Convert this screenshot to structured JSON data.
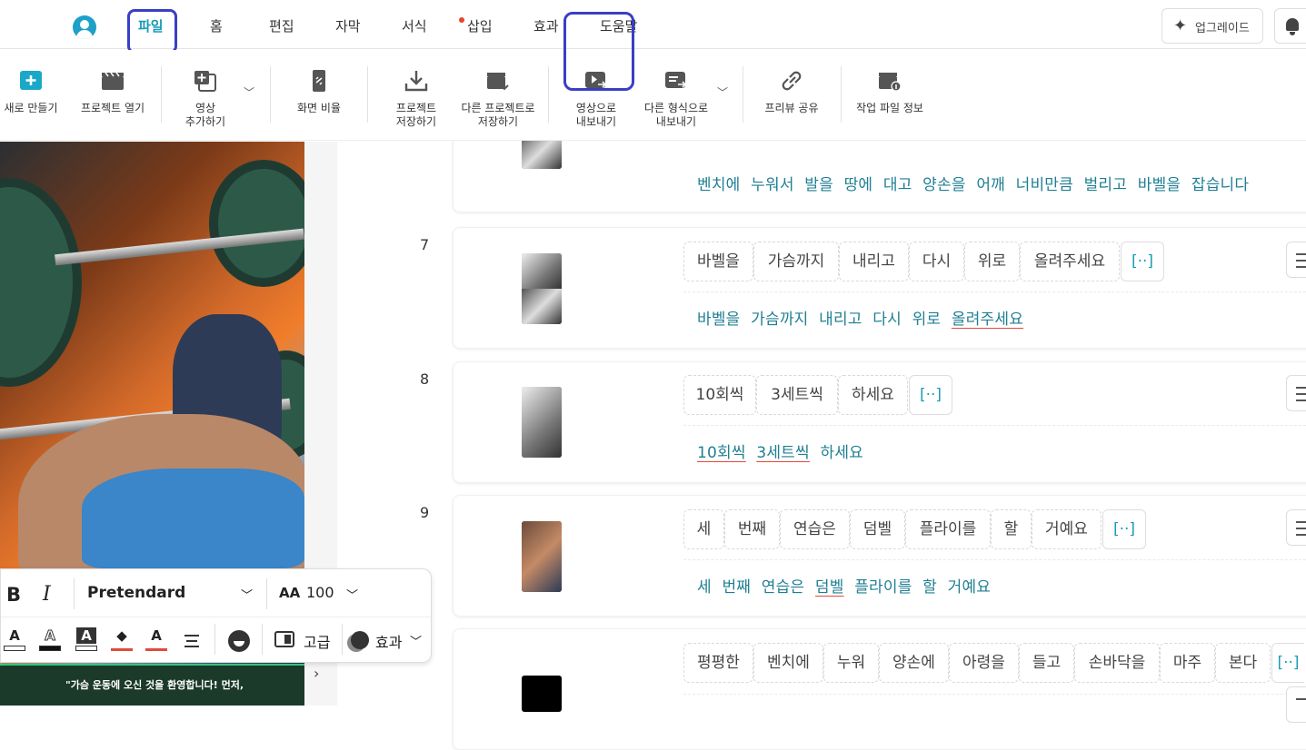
{
  "menu": {
    "tabs": [
      "파일",
      "홈",
      "편집",
      "자막",
      "서식",
      "삽입",
      "효과",
      "도움말"
    ],
    "active_tab": "파일",
    "upgrade_label": "업그레이드"
  },
  "toolbar": {
    "new_label": "새로 만들기",
    "open_label": "프로젝트 열기",
    "add_video_label": "영상\n추가하기",
    "aspect_label": "화면 비율",
    "save_label": "프로젝트\n저장하기",
    "save_as_label": "다른 프로젝트로\n저장하기",
    "export_video_label": "영상으로\n내보내기",
    "export_other_label": "다른 형식으로\n내보내기",
    "share_preview_label": "프리뷰 공유",
    "file_info_label": "작업 파일 정보"
  },
  "format_bar": {
    "bold": "B",
    "italic": "I",
    "font_name": "Pretendard",
    "size_icon": "AA",
    "font_size": "100",
    "quality_label": "고급",
    "effects_label": "효과"
  },
  "preview": {
    "caption_text": "\"가슴 운동에 오신 것을 환영합니다! 먼저,"
  },
  "scenes": {
    "s6": {
      "sentence": [
        "벤치에",
        "누워서",
        "발을",
        "땅에",
        "대고",
        "양손을",
        "어깨",
        "너비만큼",
        "벌리고",
        "바벨을",
        "잡습니다"
      ]
    },
    "s7": {
      "num": "7",
      "chips": [
        "바벨을",
        "가슴까지",
        "내리고",
        "다시",
        "위로",
        "올려주세요",
        "[··]"
      ],
      "sentence": [
        "바벨을",
        "가슴까지",
        "내리고",
        "다시",
        "위로",
        "올려주세요"
      ]
    },
    "s8": {
      "num": "8",
      "chips": [
        "10회씩",
        "3세트씩",
        "하세요",
        "[··]"
      ],
      "sentence": [
        "10회씩",
        "3세트씩",
        "하세요"
      ]
    },
    "s9": {
      "num": "9",
      "chips": [
        "세",
        "번째",
        "연습은",
        "덤벨",
        "플라이를",
        "할",
        "거예요",
        "[··]"
      ],
      "sentence": [
        "세",
        "번째",
        "연습은",
        "덤벨",
        "플라이를",
        "할",
        "거예요"
      ]
    },
    "s10": {
      "chips": [
        "평평한",
        "벤치에",
        "누워",
        "양손에",
        "아령을",
        "들고",
        "손바닥을",
        "마주",
        "본다",
        "[··]"
      ]
    }
  }
}
